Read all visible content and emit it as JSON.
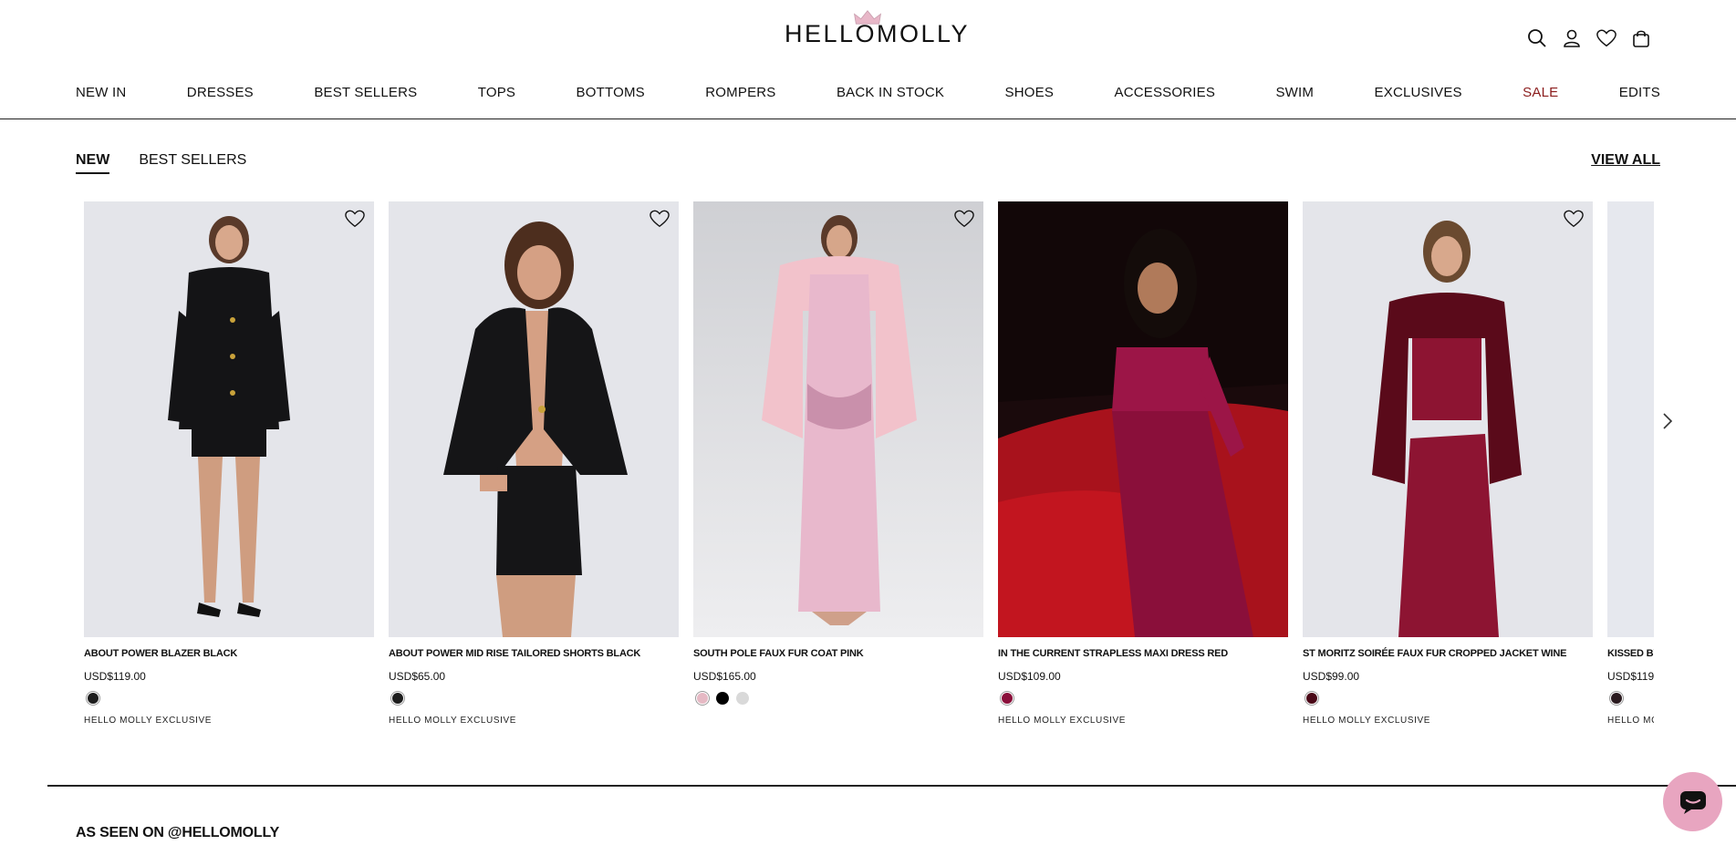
{
  "header": {
    "logo_text": "HELLOMOLLY",
    "nav": [
      {
        "label": "NEW IN"
      },
      {
        "label": "DRESSES"
      },
      {
        "label": "BEST SELLERS"
      },
      {
        "label": "TOPS"
      },
      {
        "label": "BOTTOMS"
      },
      {
        "label": "ROMPERS"
      },
      {
        "label": "BACK IN STOCK"
      },
      {
        "label": "SHOES"
      },
      {
        "label": "ACCESSORIES"
      },
      {
        "label": "SWIM"
      },
      {
        "label": "EXCLUSIVES"
      },
      {
        "label": "SALE"
      },
      {
        "label": "EDITS"
      }
    ],
    "icons": [
      "search-icon",
      "account-icon",
      "wishlist-icon",
      "bag-icon"
    ]
  },
  "tabs": {
    "new": "NEW",
    "best_sellers": "BEST SELLERS",
    "view_all": "VIEW ALL"
  },
  "products": [
    {
      "name": "ABOUT POWER BLAZER BLACK",
      "price": "USD$119.00",
      "tag": "HELLO MOLLY EXCLUSIVE",
      "swatches": [
        "#1d1d1d"
      ]
    },
    {
      "name": "ABOUT POWER MID RISE TAILORED SHORTS BLACK",
      "price": "USD$65.00",
      "tag": "HELLO MOLLY EXCLUSIVE",
      "swatches": [
        "#1d1d1d"
      ]
    },
    {
      "name": "SOUTH POLE FAUX FUR COAT PINK",
      "price": "USD$165.00",
      "tag": "",
      "swatches": [
        "#e6b9c4",
        "#000000",
        "#d9d9d9"
      ]
    },
    {
      "name": "IN THE CURRENT STRAPLESS MAXI DRESS RED",
      "price": "USD$109.00",
      "tag": "HELLO MOLLY EXCLUSIVE",
      "swatches": [
        "#8a0f3a"
      ]
    },
    {
      "name": "ST MORITZ SOIRÉE FAUX FUR CROPPED JACKET WINE",
      "price": "USD$99.00",
      "tag": "HELLO MOLLY EXCLUSIVE",
      "swatches": [
        "#4a0817"
      ]
    },
    {
      "name": "KISSED BY",
      "price": "USD$119",
      "tag": "HELLO MO",
      "swatches": [
        "#2a1a1f"
      ]
    }
  ],
  "section": {
    "as_seen_on": "AS SEEN ON @HELLOMOLLY"
  },
  "colors": {
    "sale": "#8b1c1c",
    "chat_button": "#e8a5c0"
  }
}
